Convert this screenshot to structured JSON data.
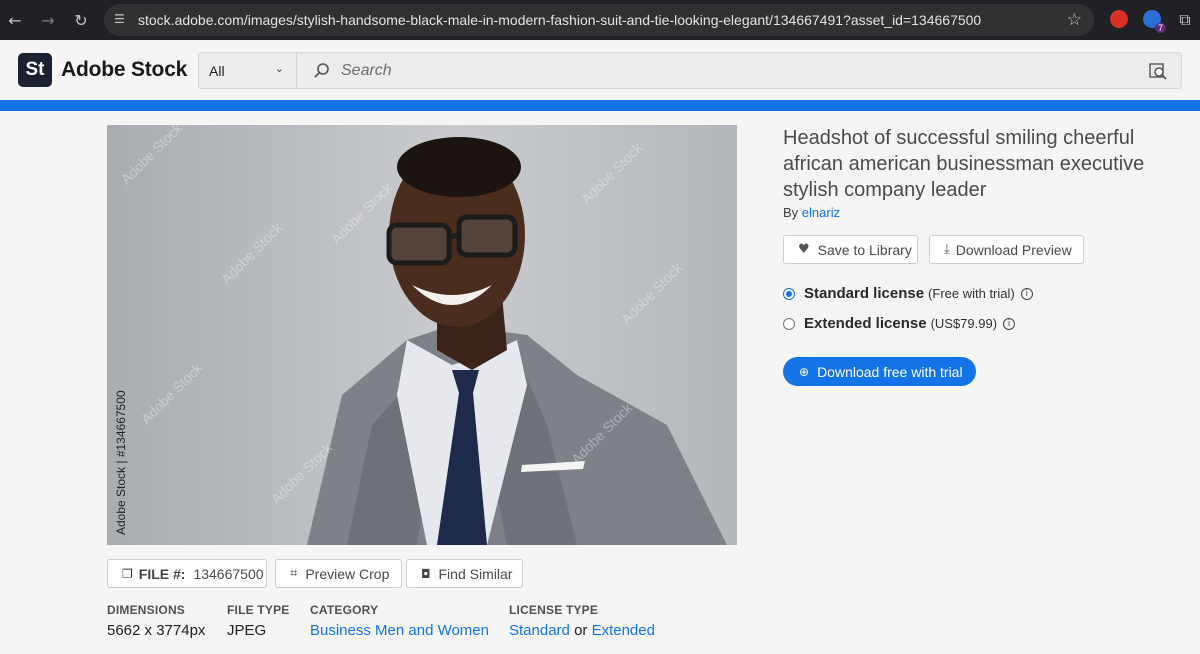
{
  "browser": {
    "url": "stock.adobe.com/images/stylish-handsome-black-male-in-modern-fashion-suit-and-tie-looking-elegant/134667491?asset_id=134667500",
    "extension_badge": "7"
  },
  "header": {
    "logo_mark": "St",
    "logo_text": "Adobe Stock",
    "filter_value": "All",
    "search_placeholder": "Search"
  },
  "photo": {
    "watermark_overlay": "Adobe Stock",
    "side_credit": "Adobe Stock | #134667500"
  },
  "asset": {
    "title": "Headshot of successful smiling cheerful african american businessman executive stylish company leader",
    "by_prefix": "By",
    "author": "elnariz"
  },
  "actions": {
    "save_to_library": "Save to Library",
    "download_preview": "Download Preview",
    "file_label": "FILE #:",
    "file_number": "134667500",
    "preview_crop": "Preview Crop",
    "find_similar": "Find Similar"
  },
  "licenses": [
    {
      "name": "Standard license",
      "price": "(Free with trial)",
      "selected": true
    },
    {
      "name": "Extended license",
      "price": "(US$79.99)",
      "selected": false
    }
  ],
  "cta": {
    "label": "Download free with trial"
  },
  "details": {
    "dimensions_label": "DIMENSIONS",
    "dimensions_value": "5662 x 3774px",
    "filetype_label": "FILE TYPE",
    "filetype_value": "JPEG",
    "category_label": "CATEGORY",
    "category_value": "Business Men and Women",
    "licensetype_label": "LICENSE TYPE",
    "license_standard": "Standard",
    "license_or": "or",
    "license_extended": "Extended"
  },
  "colors": {
    "accent": "#1473e6",
    "chrome_bg": "#202124",
    "page_bg": "#f5f5f5"
  }
}
